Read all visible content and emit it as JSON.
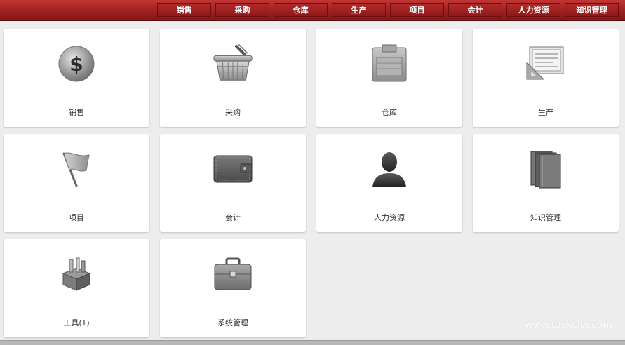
{
  "nav": {
    "items": [
      "销售",
      "采购",
      "仓库",
      "生产",
      "项目",
      "会计",
      "人力资源",
      "知识管理"
    ]
  },
  "tiles": [
    {
      "label": "销售",
      "icon": "dollar-coin-icon"
    },
    {
      "label": "采购",
      "icon": "shopping-basket-icon"
    },
    {
      "label": "仓库",
      "icon": "storage-box-icon"
    },
    {
      "label": "生产",
      "icon": "manufacturing-drawing-icon"
    },
    {
      "label": "项目",
      "icon": "flag-icon"
    },
    {
      "label": "会计",
      "icon": "wallet-icon"
    },
    {
      "label": "人力资源",
      "icon": "person-silhouette-icon"
    },
    {
      "label": "知识管理",
      "icon": "books-icon"
    },
    {
      "label": "工具(T)",
      "icon": "toolbox-icon"
    },
    {
      "label": "系统管理",
      "icon": "briefcase-icon"
    }
  ],
  "watermark": "www.taskcity.com",
  "colors": {
    "topbar": "#a52424",
    "background": "#ededed"
  }
}
